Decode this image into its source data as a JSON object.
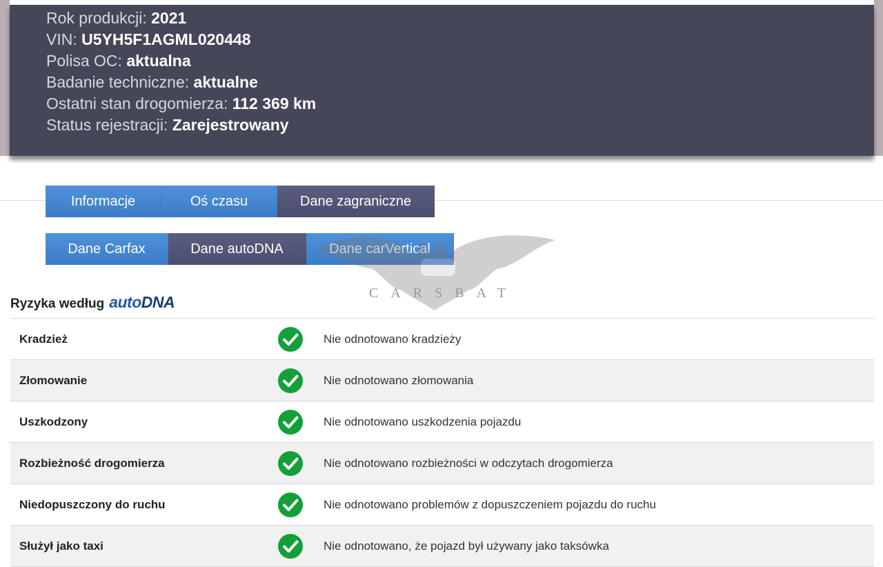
{
  "vehicle_info": [
    {
      "label": "Rok produkcji:",
      "value": "2021"
    },
    {
      "label": "VIN:",
      "value": "U5YH5F1AGML020448"
    },
    {
      "label": "Polisa OC:",
      "value": "aktualna"
    },
    {
      "label": "Badanie techniczne:",
      "value": "aktualne"
    },
    {
      "label": "Ostatni stan drogomierza:",
      "value": "112 369 km"
    },
    {
      "label": "Status rejestracji:",
      "value": "Zarejestrowany"
    }
  ],
  "main_tabs": [
    {
      "label": "Informacje",
      "active": false
    },
    {
      "label": "Oś czasu",
      "active": false
    },
    {
      "label": "Dane zagraniczne",
      "active": true
    }
  ],
  "source_tabs": [
    {
      "label": "Dane Carfax",
      "active": false
    },
    {
      "label": "Dane autoDNA",
      "active": true
    },
    {
      "label": "Dane carVertical",
      "active": false
    }
  ],
  "watermark": {
    "text": "CARSBAT"
  },
  "section": {
    "title": "Ryzyka według",
    "brand_prefix": "auto",
    "brand_suffix": "DNA"
  },
  "risks": [
    {
      "name": "Kradzież",
      "status": "ok",
      "description": "Nie odnotowano kradzieży"
    },
    {
      "name": "Złomowanie",
      "status": "ok",
      "description": "Nie odnotowano złomowania"
    },
    {
      "name": "Uszkodzony",
      "status": "ok",
      "description": "Nie odnotowano uszkodzenia pojazdu"
    },
    {
      "name": "Rozbieżność drogomierza",
      "status": "ok",
      "description": "Nie odnotowano rozbieżności w odczytach drogomierza"
    },
    {
      "name": "Niedopuszczony do ruchu",
      "status": "ok",
      "description": "Nie odnotowano problemów z dopuszczeniem pojazdu do ruchu"
    },
    {
      "name": "Służył jako taxi",
      "status": "ok",
      "description": "Nie odnotowano, że pojazd był używany jako taksówka"
    }
  ],
  "colors": {
    "header_bg": "#454758",
    "tab_blue": "#4387d0",
    "tab_active": "#55577a",
    "ok_green": "#14a038"
  }
}
